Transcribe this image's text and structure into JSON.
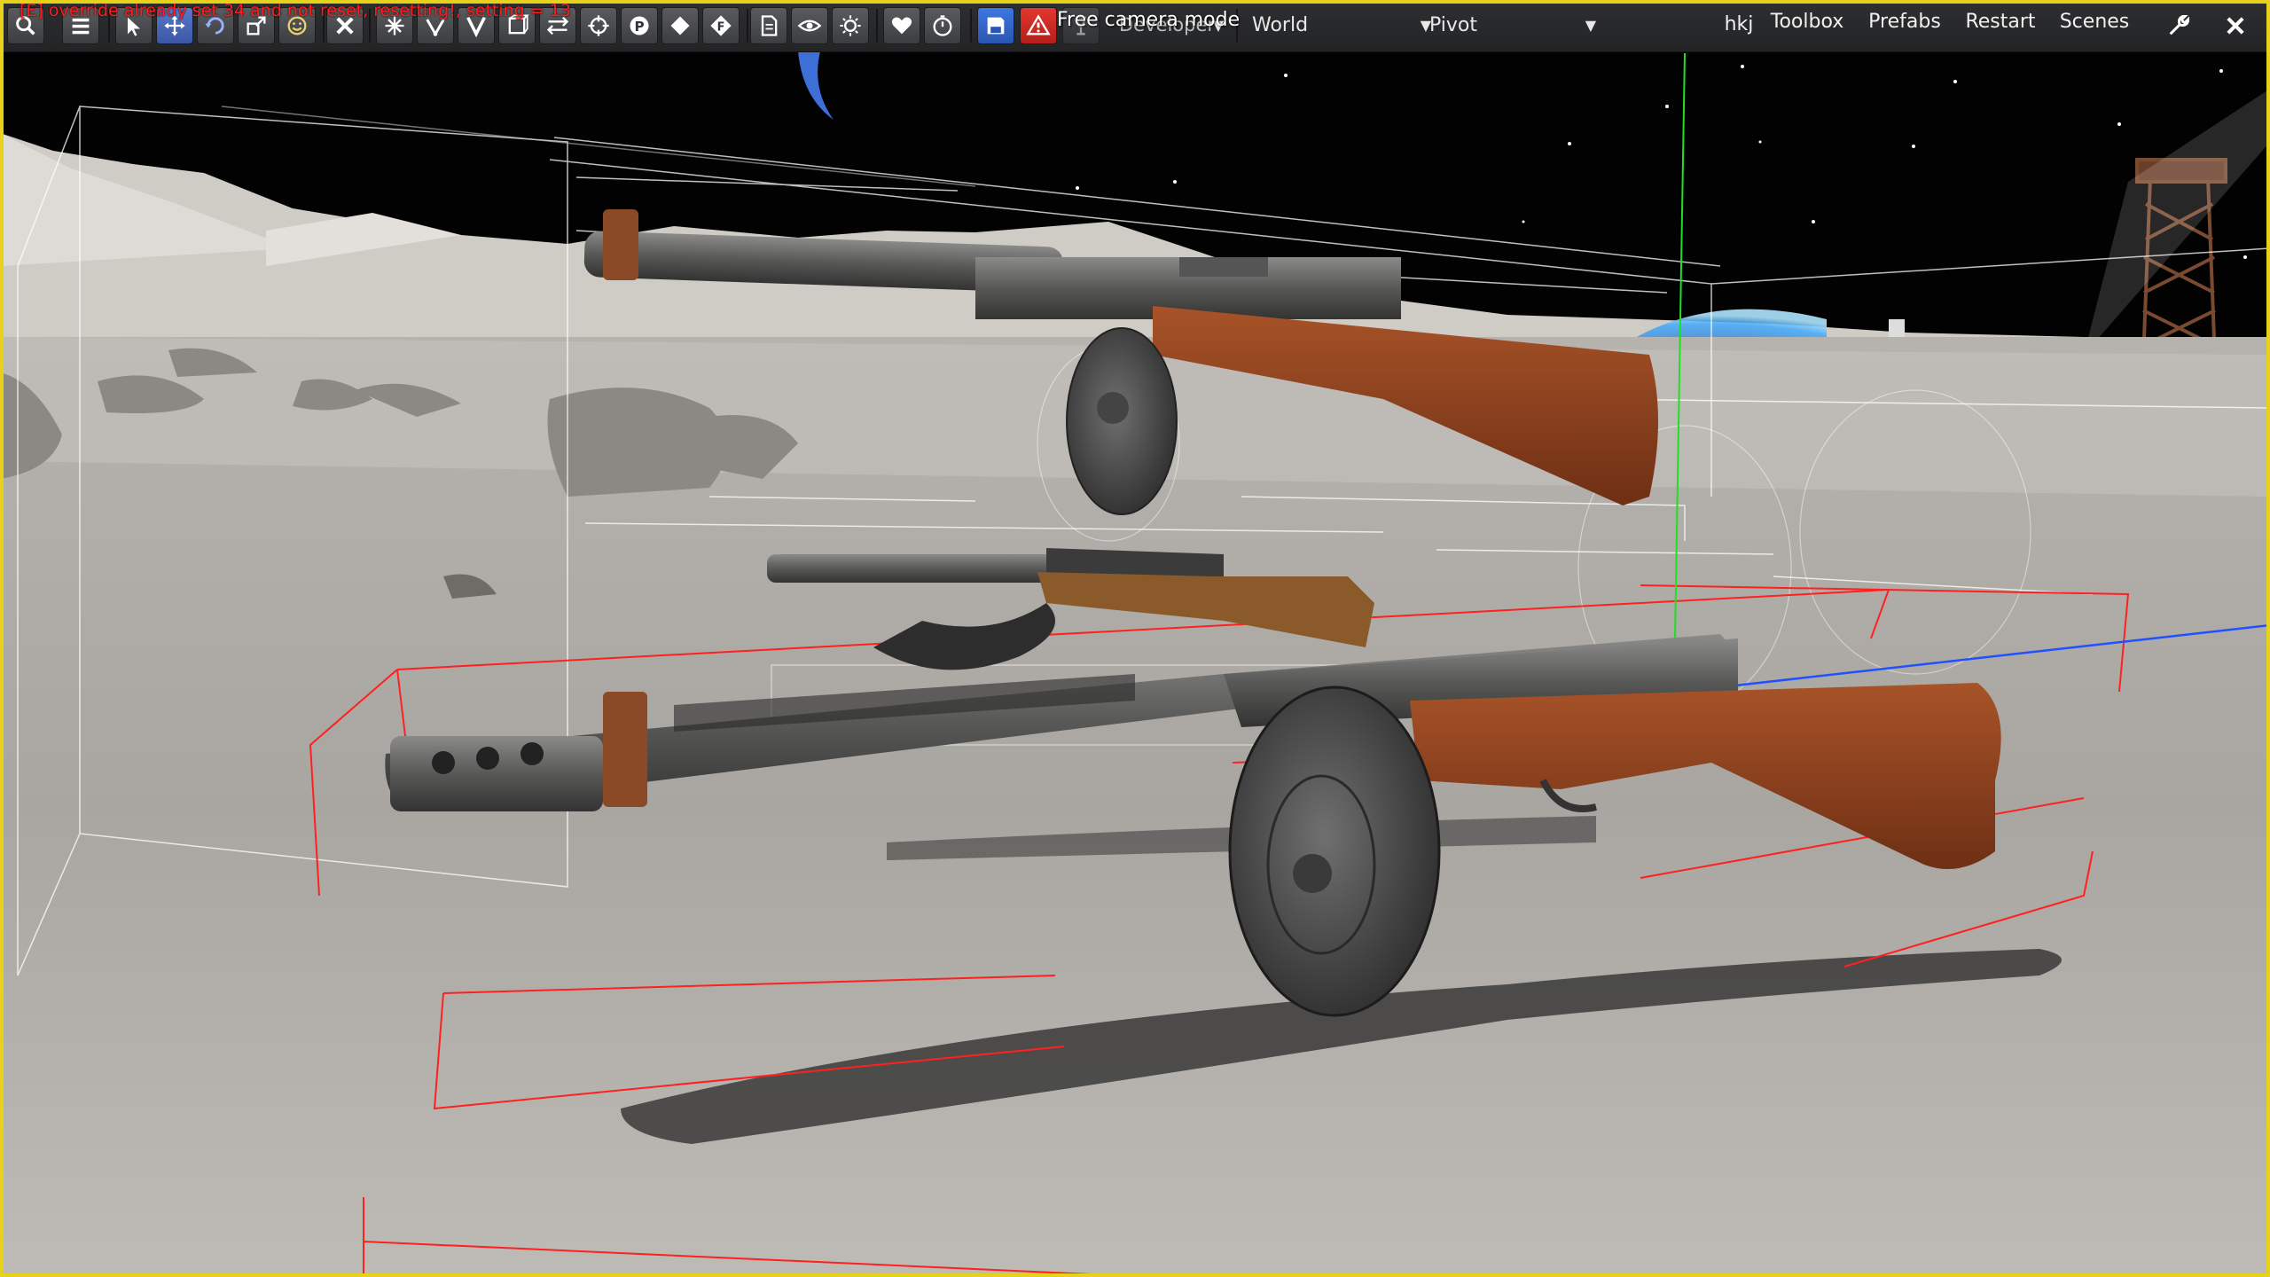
{
  "error": "[E] override already set 34 and not reset, resetting!, setting = 13",
  "camera_mode": "Free camera mode",
  "mode_dropdown": "Developer",
  "space_dropdown": "World",
  "pivot_dropdown": "Pivot",
  "menu": {
    "user": "hkj",
    "toolbox": "Toolbox",
    "prefabs": "Prefabs",
    "restart": "Restart",
    "scenes": "Scenes"
  },
  "tool_icons": [
    "search-icon",
    "menu-icon",
    "select-icon",
    "move-icon",
    "rotate-icon",
    "scale-icon",
    "smiley-icon",
    "close-tool-icon",
    "snap-icon",
    "vertex-icon",
    "vertex-v-icon",
    "bounds-icon",
    "transform-icon",
    "crosshair-icon",
    "pivot-p-icon",
    "diamond-icon",
    "focus-f-icon",
    "document-icon",
    "eye-icon",
    "light-icon",
    "heart-icon",
    "timer-icon",
    "save-icon",
    "warning-icon",
    "lamp-icon"
  ],
  "colors": {
    "frame": "#e6d21b",
    "error_text": "#ff1c1c",
    "gizmo_x": "#2050ff",
    "gizmo_y": "#20e020",
    "bounds": "#ff2020",
    "wood": "#8a3f1c",
    "metal": "#4a4a4a"
  }
}
